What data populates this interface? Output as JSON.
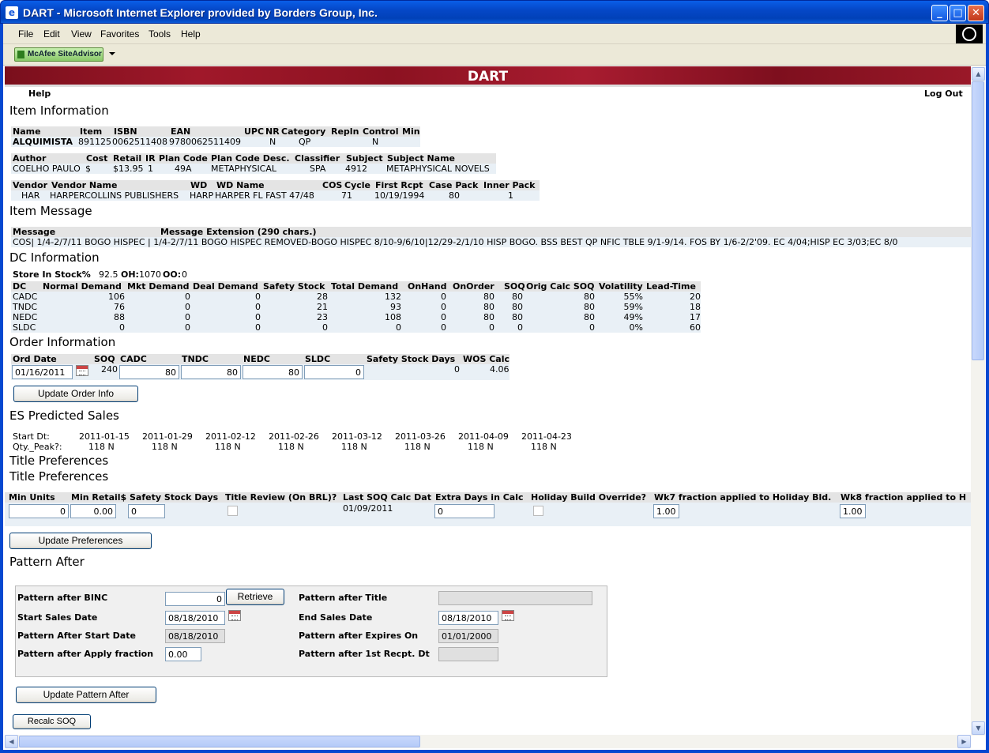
{
  "window": {
    "title": "DART - Microsoft Internet Explorer provided by Borders Group, Inc."
  },
  "menu": [
    "File",
    "Edit",
    "View",
    "Favorites",
    "Tools",
    "Help"
  ],
  "toolbar": {
    "siteadvisor": "McAfee SiteAdvisor"
  },
  "app": {
    "banner": "DART",
    "help": "Help",
    "logout": "Log Out"
  },
  "sections": {
    "item_info": "Item Information",
    "item_message": "Item Message",
    "dc_info": "DC Information",
    "order_info": "Order Information",
    "es_sales": "ES Predicted Sales",
    "title_prefs_1": "Title Preferences",
    "title_prefs_2": "Title Preferences",
    "pattern_after": "Pattern After"
  },
  "item1": {
    "headers": [
      "Name",
      "Item",
      "ISBN",
      "EAN",
      "UPC",
      "NR",
      "Category",
      "Repln",
      "Control",
      "Min"
    ],
    "values": [
      "ALQUIMISTA",
      "891125",
      "0062511408",
      "9780062511409",
      "",
      "N",
      "QP",
      "",
      "N",
      ""
    ]
  },
  "item2": {
    "headers": [
      "Author",
      "Cost",
      "Retail",
      "IR",
      "Plan Code",
      "Plan Code Desc.",
      "Classifier",
      "Subject",
      "Subject Name"
    ],
    "values": [
      "COELHO PAULO",
      "$",
      "$13.95",
      "1",
      "49A",
      "METAPHYSICAL",
      "SPA",
      "4912",
      "METAPHYSICAL NOVELS"
    ]
  },
  "item3": {
    "headers": [
      "Vendor",
      "Vendor Name",
      "WD",
      "WD Name",
      "COS",
      "Cycle",
      "First Rcpt",
      "Case Pack",
      "Inner Pack"
    ],
    "values": [
      "HAR",
      "HARPERCOLLINS PUBLISHERS",
      "HARP",
      "HARPER FL FAST 47/48",
      "",
      "71",
      "10/19/1994",
      "80",
      "1"
    ]
  },
  "message": {
    "headers": [
      "Message",
      "Message Extension (290 chars.)"
    ],
    "text": "COS| 1/4-2/7/11 BOGO HISPEC | 1/4-2/7/11 BOGO HISPEC REMOVED-BOGO HISPEC 8/10-9/6/10|12/29-2/1/10 HISP BOGO. BSS BEST QP NFIC TBLE 9/1-9/14. FOS BY 1/6-2/2'09. EC 4/04;HISP EC 3/03;EC 8/0"
  },
  "store": {
    "instock_label": "Store In Stock%",
    "instock": "92.5",
    "oh_label": "OH:",
    "oh": "1070",
    "oo_label": "OO:",
    "oo": "0"
  },
  "dc_table": {
    "headers": [
      "DC",
      "Normal Demand",
      "Mkt Demand",
      "Deal Demand",
      "Safety Stock",
      "Total Demand",
      "OnHand",
      "OnOrder",
      "SOQ",
      "Orig Calc SOQ",
      "Volatility",
      "Lead-Time"
    ],
    "rows": [
      [
        "CADC",
        "106",
        "0",
        "0",
        "28",
        "132",
        "0",
        "80",
        "80",
        "80",
        "55%",
        "20"
      ],
      [
        "TNDC",
        "76",
        "0",
        "0",
        "21",
        "93",
        "0",
        "80",
        "80",
        "80",
        "59%",
        "18"
      ],
      [
        "NEDC",
        "88",
        "0",
        "0",
        "23",
        "108",
        "0",
        "80",
        "80",
        "80",
        "49%",
        "17"
      ],
      [
        "SLDC",
        "0",
        "0",
        "0",
        "0",
        "0",
        "0",
        "0",
        "0",
        "0",
        "0%",
        "60"
      ]
    ]
  },
  "order": {
    "headers": [
      "Ord Date",
      "SOQ",
      "CADC",
      "TNDC",
      "NEDC",
      "SLDC",
      "Safety Stock Days",
      "WOS Calc"
    ],
    "ord_date": "01/16/2011",
    "soq": "240",
    "cadc": "80",
    "tndc": "80",
    "nedc": "80",
    "sldc": "0",
    "ss_days": "0",
    "wos_calc": "4.06",
    "update_button": "Update Order Info"
  },
  "es": {
    "start_label": "Start Dt:",
    "qty_label": "Qty._Peak?:",
    "dates": [
      "2011-01-15",
      "2011-01-29",
      "2011-02-12",
      "2011-02-26",
      "2011-03-12",
      "2011-03-26",
      "2011-04-09",
      "2011-04-23"
    ],
    "qty": [
      "118 N",
      "118 N",
      "118 N",
      "118 N",
      "118 N",
      "118 N",
      "118 N",
      "118 N"
    ]
  },
  "prefs": {
    "headers": [
      "Min Units",
      "Min Retail$",
      "Safety Stock Days",
      "Title Review (On BRL)?",
      "Last SOQ Calc Dat",
      "Extra Days in Calc",
      "Holiday Build Override?",
      "Wk7 fraction applied to Holiday Bld.",
      "Wk8 fraction applied to H"
    ],
    "min_units": "0",
    "min_retail": "0.00",
    "ss_days": "0",
    "last_soq": "01/09/2011",
    "extra_days": "0",
    "wk7": "1.00",
    "wk8": "1.00",
    "update_button": "Update Preferences"
  },
  "pattern": {
    "binc_label": "Pattern after BINC",
    "binc": "0",
    "retrieve": "Retrieve",
    "title_label": "Pattern after Title",
    "title": "",
    "start_label": "Start Sales Date",
    "start": "08/18/2010",
    "end_label": "End Sales Date",
    "end": "08/18/2010",
    "pstart_label": "Pattern After Start Date",
    "pstart": "08/18/2010",
    "expires_label": "Pattern after Expires On",
    "expires": "01/01/2000",
    "fraction_label": "Pattern after Apply fraction",
    "fraction": "0.00",
    "first_rcpt_label": "Pattern after 1st Recpt. Dt",
    "first_rcpt": "",
    "update_button": "Update Pattern After",
    "recalc_button": "Recalc SOQ"
  },
  "colors": {
    "banner": "#9a1828",
    "titlebar": "#0548c8",
    "table_header": "#e4e4e4"
  }
}
